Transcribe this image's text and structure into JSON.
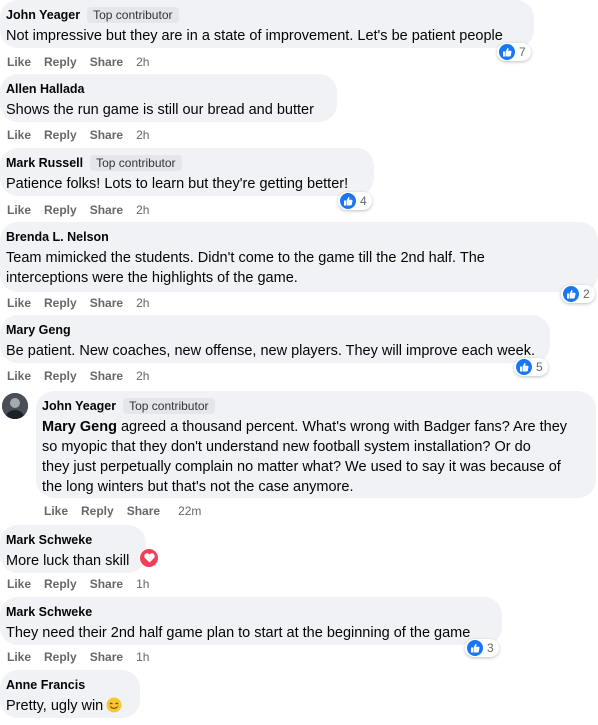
{
  "comments": [
    {
      "author": "John Yeager",
      "badge": "Top contributor",
      "text": "Not impressive but they are in a state of improvement. Let's be patient people",
      "like": "Like",
      "reply": "Reply",
      "share": "Share",
      "time": "2h",
      "reactions": "7"
    },
    {
      "author": "Allen Hallada",
      "text": "Shows the run game is still our bread and butter",
      "like": "Like",
      "reply": "Reply",
      "share": "Share",
      "time": "2h"
    },
    {
      "author": "Mark Russell",
      "badge": "Top contributor",
      "text": "Patience folks! Lots to learn but they're getting better!",
      "like": "Like",
      "reply": "Reply",
      "share": "Share",
      "time": "2h",
      "reactions": "4"
    },
    {
      "author": "Brenda L. Nelson",
      "text_line1": "Team mimicked the students. Didn't come to the game till the 2nd half. The",
      "text_line2": "interceptions were the highlights of the game.",
      "like": "Like",
      "reply": "Reply",
      "share": "Share",
      "time": "2h",
      "reactions": "2"
    },
    {
      "author": "Mary Geng",
      "text": "Be patient. New coaches, new offense, new players. They will improve each week.",
      "like": "Like",
      "reply": "Reply",
      "share": "Share",
      "time": "2h",
      "reactions": "5"
    },
    {
      "author": "John Yeager",
      "badge": "Top contributor",
      "mention": "Mary Geng",
      "text_line1": " agreed a thousand percent. What's wrong with Badger fans? Are they",
      "text_line2": "so myopic that they don't understand new football system installation? Or do",
      "text_line3": "they just perpetually complain no matter what? We used to say it was because of",
      "text_line4": "the long winters but that's not the case anymore.",
      "like": "Like",
      "reply": "Reply",
      "share": "Share",
      "time": "22m"
    },
    {
      "author": "Mark Schweke",
      "text": "More luck than skill",
      "like": "Like",
      "reply": "Reply",
      "share": "Share",
      "time": "1h",
      "reaction_type": "heart-icon"
    },
    {
      "author": "Mark Schweke",
      "text": "They need their 2nd half game plan to start at the beginning of the game",
      "like": "Like",
      "reply": "Reply",
      "share": "Share",
      "time": "1h",
      "reactions": "3"
    },
    {
      "author": "Anne Francis",
      "text": "Pretty, ugly win",
      "emoji": "smiling-face-icon"
    }
  ],
  "colors": {
    "bubble": "#f0f2f5",
    "like_blue": "#1877f2",
    "heart_red": "#f33e58",
    "secondary_text": "#65676b"
  }
}
